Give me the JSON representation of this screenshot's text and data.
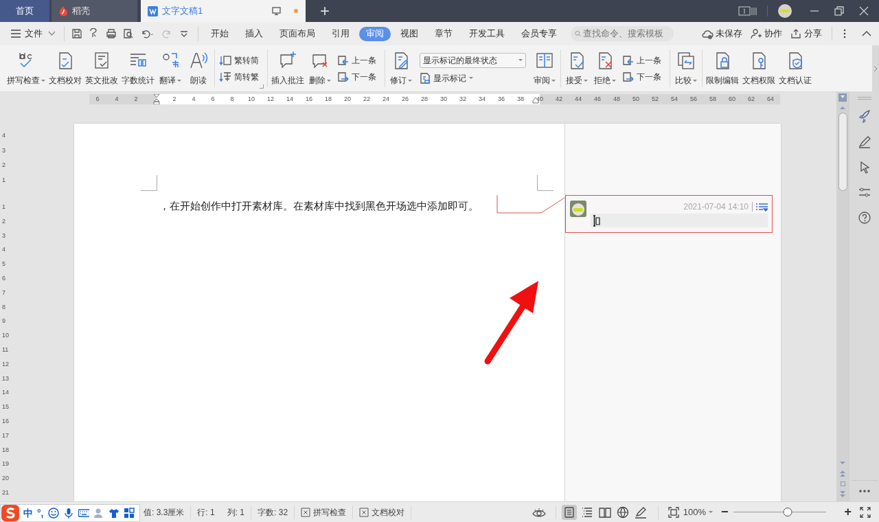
{
  "title_bar": {
    "tabs": [
      {
        "kind": "home",
        "label": "首页",
        "selected": false
      },
      {
        "kind": "app",
        "label": "稻壳",
        "selected": false
      },
      {
        "kind": "doc",
        "label": "文字文稿1",
        "selected": true,
        "unsaved": true
      }
    ],
    "new_tab": "+"
  },
  "menu": {
    "file": "文件",
    "tabs": [
      {
        "label": "开始",
        "selected": false
      },
      {
        "label": "插入",
        "selected": false
      },
      {
        "label": "页面布局",
        "selected": false
      },
      {
        "label": "引用",
        "selected": false
      },
      {
        "label": "审阅",
        "selected": true
      },
      {
        "label": "视图",
        "selected": false
      },
      {
        "label": "章节",
        "selected": false
      },
      {
        "label": "开发工具",
        "selected": false
      },
      {
        "label": "会员专享",
        "selected": false
      }
    ],
    "search": {
      "placeholder": "查找命令、搜索模板"
    },
    "actions": [
      "未保存",
      "协作",
      "分享"
    ]
  },
  "ribbon": {
    "groups": [
      [
        {
          "kind": "large",
          "label": "拼写检查",
          "dropdown": true
        },
        {
          "kind": "large",
          "label": "文档校对",
          "dropdown": false
        },
        {
          "kind": "large",
          "label": "英文批改",
          "dropdown": false
        },
        {
          "kind": "large",
          "label": "字数统计",
          "dropdown": false
        },
        {
          "kind": "large",
          "label": "翻译",
          "dropdown": true
        },
        {
          "kind": "large",
          "label": "朗读",
          "dropdown": false
        }
      ],
      [
        {
          "kind": "pair",
          "labels": [
            "繁转简",
            "简转繁"
          ]
        }
      ],
      [
        {
          "kind": "large",
          "label": "插入批注",
          "dropdown": false
        },
        {
          "kind": "large",
          "label": "删除",
          "dropdown": true
        },
        {
          "kind": "pair",
          "labels": [
            "上一条",
            "下一条"
          ]
        }
      ],
      [
        {
          "kind": "large",
          "label": "修订",
          "dropdown": true
        },
        {
          "kind": "select",
          "value": "显示标记的最终状态",
          "label": "显示标记"
        },
        {
          "kind": "large",
          "label": "审阅",
          "dropdown": true
        }
      ],
      [
        {
          "kind": "large",
          "label": "接受",
          "dropdown": true
        },
        {
          "kind": "large",
          "label": "拒绝",
          "dropdown": true
        },
        {
          "kind": "pair",
          "labels": [
            "上一条",
            "下一条"
          ]
        }
      ],
      [
        {
          "kind": "large",
          "label": "比较",
          "dropdown": true
        }
      ],
      [
        {
          "kind": "large",
          "label": "限制编辑",
          "dropdown": false
        },
        {
          "kind": "large",
          "label": "文档权限",
          "dropdown": false
        },
        {
          "kind": "large",
          "label": "文档认证",
          "dropdown": false
        }
      ]
    ]
  },
  "ruler": {
    "horizontal": [
      "6",
      "4",
      "2",
      "2",
      "4",
      "6",
      "8",
      "10",
      "12",
      "14",
      "16",
      "18",
      "20",
      "22",
      "24",
      "26",
      "28",
      "30",
      "32",
      "34",
      "36",
      "38",
      "40",
      "42",
      "44",
      "46",
      "48",
      "50",
      "52",
      "54",
      "56",
      "58",
      "60",
      "62",
      "64"
    ],
    "vertical": [
      "4",
      "3",
      "2",
      "1",
      "1",
      "2",
      "3",
      "4",
      "5",
      "6",
      "7",
      "8",
      "9",
      "10",
      "11",
      "12",
      "13",
      "14",
      "15",
      "16",
      "17",
      "18",
      "19",
      "20",
      "21"
    ]
  },
  "document": {
    "text": "，在开始创作中打开素材库。在素材库中找到黑色开场选中添加即可。",
    "comment": {
      "time": "2021-07-04 14:10"
    }
  },
  "status_bar": {
    "ime": [
      "中",
      "°,"
    ],
    "items": [
      "值: 3.3厘米",
      "行: 1",
      "列: 1",
      "字数: 32"
    ],
    "buttons": [
      "拼写检查",
      "文档校对"
    ],
    "views": [
      {
        "selected": true
      },
      {
        "selected": false
      },
      {
        "selected": false
      },
      {
        "selected": false
      },
      {
        "selected": false
      }
    ],
    "zoom": {
      "value": "100%",
      "level": 0.58,
      "minus": "−",
      "plus": "+"
    }
  }
}
